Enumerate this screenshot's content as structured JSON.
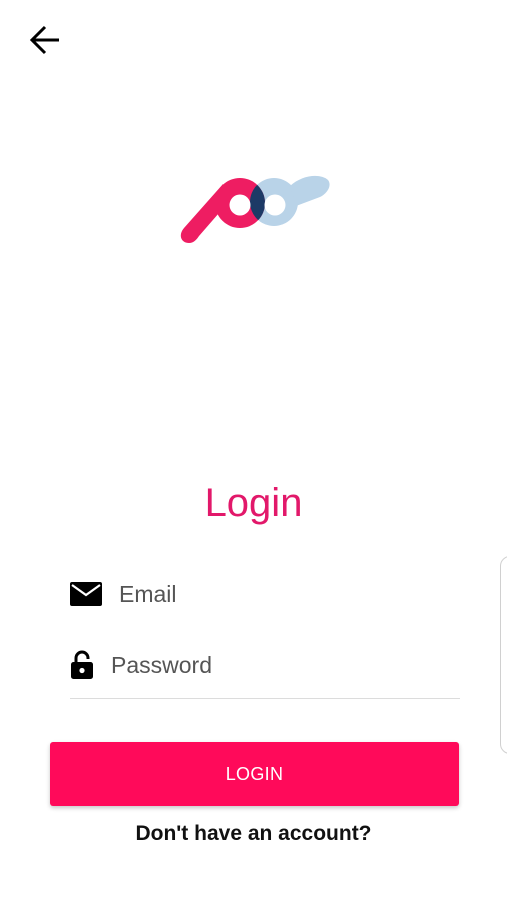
{
  "colors": {
    "accent": "#ff0a5a",
    "title": "#e2186a",
    "logo_pink": "#ee1d62",
    "logo_blue": "#b9d3e8",
    "logo_overlap": "#1d3a66"
  },
  "header": {
    "back_icon": "arrow-left-icon"
  },
  "title": "Login",
  "email": {
    "icon": "envelope-icon",
    "placeholder": "Email",
    "value": ""
  },
  "password": {
    "icon": "lock-icon",
    "placeholder": "Password",
    "value": ""
  },
  "login_button": {
    "label": "LOGIN"
  },
  "signup_link": "Don't have an account?"
}
